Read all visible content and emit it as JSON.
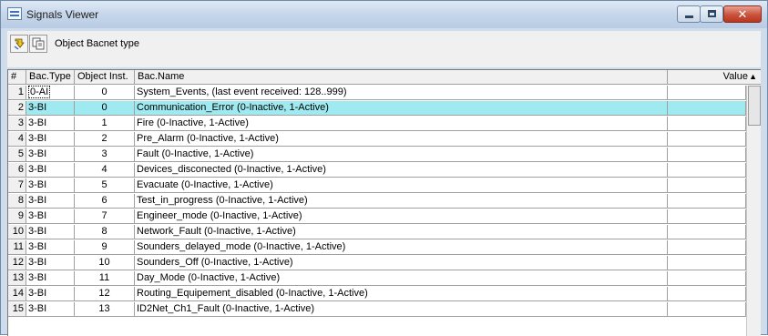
{
  "window": {
    "title": "Signals Viewer",
    "close_glyph": "✕"
  },
  "toolbar": {
    "label": "Object Bacnet type",
    "buttons": [
      {
        "icon": "refresh-arrow-icon"
      },
      {
        "icon": "copy-icon"
      }
    ]
  },
  "grid": {
    "columns": {
      "num": "#",
      "type": "Bac.Type",
      "inst": "Object Inst.",
      "name": "Bac.Name",
      "value": "Value"
    },
    "sort_arrow": "▲",
    "selected_row": 2,
    "rows": [
      {
        "num": "1",
        "type": "0-AI",
        "inst": "0",
        "name": "System_Events, (last event received: 128..999)",
        "value": ""
      },
      {
        "num": "2",
        "type": "3-BI",
        "inst": "0",
        "name": "Communication_Error (0-Inactive, 1-Active)",
        "value": ""
      },
      {
        "num": "3",
        "type": "3-BI",
        "inst": "1",
        "name": "Fire (0-Inactive, 1-Active)",
        "value": ""
      },
      {
        "num": "4",
        "type": "3-BI",
        "inst": "2",
        "name": "Pre_Alarm (0-Inactive, 1-Active)",
        "value": ""
      },
      {
        "num": "5",
        "type": "3-BI",
        "inst": "3",
        "name": "Fault (0-Inactive, 1-Active)",
        "value": ""
      },
      {
        "num": "6",
        "type": "3-BI",
        "inst": "4",
        "name": "Devices_disconected (0-Inactive, 1-Active)",
        "value": ""
      },
      {
        "num": "7",
        "type": "3-BI",
        "inst": "5",
        "name": "Evacuate (0-Inactive, 1-Active)",
        "value": ""
      },
      {
        "num": "8",
        "type": "3-BI",
        "inst": "6",
        "name": "Test_in_progress (0-Inactive, 1-Active)",
        "value": ""
      },
      {
        "num": "9",
        "type": "3-BI",
        "inst": "7",
        "name": "Engineer_mode (0-Inactive, 1-Active)",
        "value": ""
      },
      {
        "num": "10",
        "type": "3-BI",
        "inst": "8",
        "name": "Network_Fault (0-Inactive, 1-Active)",
        "value": ""
      },
      {
        "num": "11",
        "type": "3-BI",
        "inst": "9",
        "name": "Sounders_delayed_mode (0-Inactive, 1-Active)",
        "value": ""
      },
      {
        "num": "12",
        "type": "3-BI",
        "inst": "10",
        "name": "Sounders_Off (0-Inactive, 1-Active)",
        "value": ""
      },
      {
        "num": "13",
        "type": "3-BI",
        "inst": "11",
        "name": "Day_Mode (0-Inactive, 1-Active)",
        "value": ""
      },
      {
        "num": "14",
        "type": "3-BI",
        "inst": "12",
        "name": "Routing_Equipement_disabled (0-Inactive, 1-Active)",
        "value": ""
      },
      {
        "num": "15",
        "type": "3-BI",
        "inst": "13",
        "name": "ID2Net_Ch1_Fault (0-Inactive, 1-Active)",
        "value": ""
      }
    ]
  },
  "colors": {
    "selected_row": "#9fe9f0",
    "title_bar": "#c6d6ea",
    "close_button": "#c9523c"
  }
}
